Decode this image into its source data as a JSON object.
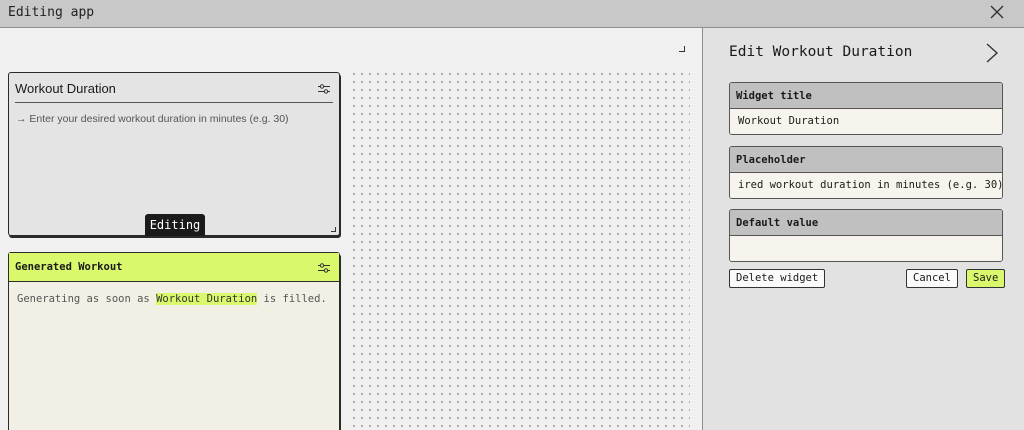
{
  "window": {
    "title": "Editing app"
  },
  "widgets": [
    {
      "title": "Workout Duration",
      "placeholder": "→ Enter your desired workout duration in minutes (e.g. 30)",
      "status_tag": "Editing"
    },
    {
      "title": "Generated Workout",
      "body_before": "Generating as soon as ",
      "body_highlight": "Workout Duration",
      "body_after": " is filled."
    }
  ],
  "panel": {
    "title": "Edit Workout Duration",
    "fields": [
      {
        "label": "Widget title",
        "value": "Workout Duration"
      },
      {
        "label": "Placeholder",
        "value": "ired workout duration in minutes (e.g. 30)"
      },
      {
        "label": "Default value",
        "value": ""
      }
    ],
    "buttons": {
      "delete": "Delete widget",
      "cancel": "Cancel",
      "save": "Save"
    }
  },
  "colors": {
    "accent": "#d9f86b",
    "titlebar": "#c8c8c8",
    "panel": "#e2e2e2",
    "canvas": "#f0f0f0"
  }
}
